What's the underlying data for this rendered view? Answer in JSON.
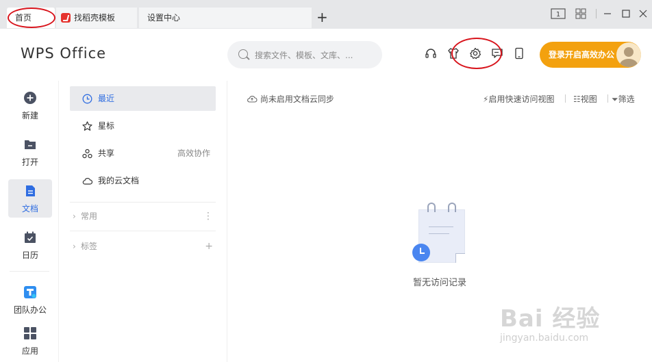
{
  "tabs": [
    {
      "label": "首页"
    },
    {
      "label": "找稻壳模板"
    },
    {
      "label": "设置中心"
    }
  ],
  "window_controls": {
    "box_label": "1"
  },
  "header": {
    "brand": "WPS Office",
    "search_placeholder": "搜索文件、模板、文库、...",
    "login_label": "登录开启高效办公"
  },
  "leftnav": [
    {
      "label": "新建"
    },
    {
      "label": "打开"
    },
    {
      "label": "文档"
    },
    {
      "label": "日历"
    },
    {
      "label": "团队办公"
    },
    {
      "label": "应用"
    }
  ],
  "midnav": {
    "items": [
      {
        "label": "最近"
      },
      {
        "label": "星标"
      },
      {
        "label": "共享",
        "extra": "高效协作"
      },
      {
        "label": "我的云文档"
      }
    ],
    "groups": [
      {
        "label": "常用",
        "action": "⋮"
      },
      {
        "label": "标签",
        "action": "+"
      }
    ]
  },
  "content": {
    "cloud_sync": "尚未启用文档云同步",
    "quick_access": "启用快速访问视图",
    "view": "视图",
    "filter": "筛选",
    "empty": "暂无访问记录"
  },
  "watermark": {
    "main": "Bai 经验",
    "sub": "jingyan.baidu.com"
  },
  "colors": {
    "accent": "#2f6de1",
    "login": "#f3a10f",
    "annotation": "#d8141c"
  }
}
